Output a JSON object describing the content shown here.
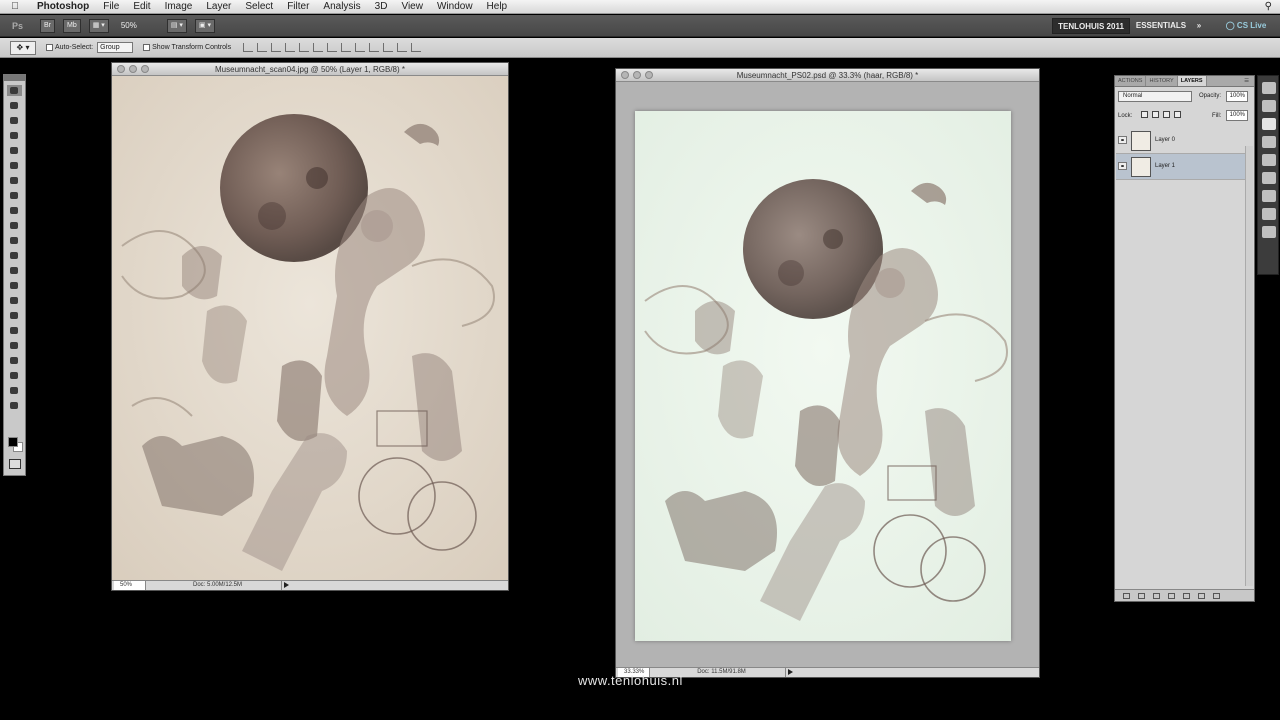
{
  "menubar": {
    "app": "Photoshop",
    "items": [
      "File",
      "Edit",
      "Image",
      "Layer",
      "Select",
      "Filter",
      "Analysis",
      "3D",
      "View",
      "Window",
      "Help"
    ]
  },
  "appbar": {
    "logo": "Ps",
    "zoom": "50%",
    "workspaces": {
      "active": "TENLOHUIS 2011",
      "essentials": "ESSENTIALS",
      "more": "»",
      "cs_live": "CS Live"
    }
  },
  "options": {
    "auto_select_label": "Auto-Select:",
    "auto_select_value": "Group",
    "show_transform_label": "Show Transform Controls"
  },
  "doc1": {
    "title": "Museumnacht_scan04.jpg @ 50% (Layer 1, RGB/8) *",
    "zoom": "50%",
    "doc_info": "Doc: 5.00M/12.5M"
  },
  "doc2": {
    "title": "Museumnacht_PS02.psd @ 33.3% (haar, RGB/8) *",
    "zoom": "33.33%",
    "doc_info": "Doc: 11.5M/91.8M"
  },
  "layers_panel": {
    "tabs": [
      "ACTIONS",
      "HISTORY",
      "LAYERS"
    ],
    "active_tab": "LAYERS",
    "blend_mode": "Normal",
    "opacity_label": "Opacity:",
    "opacity_value": "100%",
    "lock_label": "Lock:",
    "fill_label": "Fill:",
    "fill_value": "100%",
    "layers": [
      {
        "name": "Layer 0",
        "selected": false
      },
      {
        "name": "Layer 1",
        "selected": true
      }
    ]
  },
  "watermark": "www.tenlohuis.nl",
  "colors": {
    "sketch_paper_doc1": "#e9e1d5",
    "sketch_paper_doc2": "#eef6ee",
    "sketch_ink": "#5c4a42",
    "background": "#000000"
  }
}
